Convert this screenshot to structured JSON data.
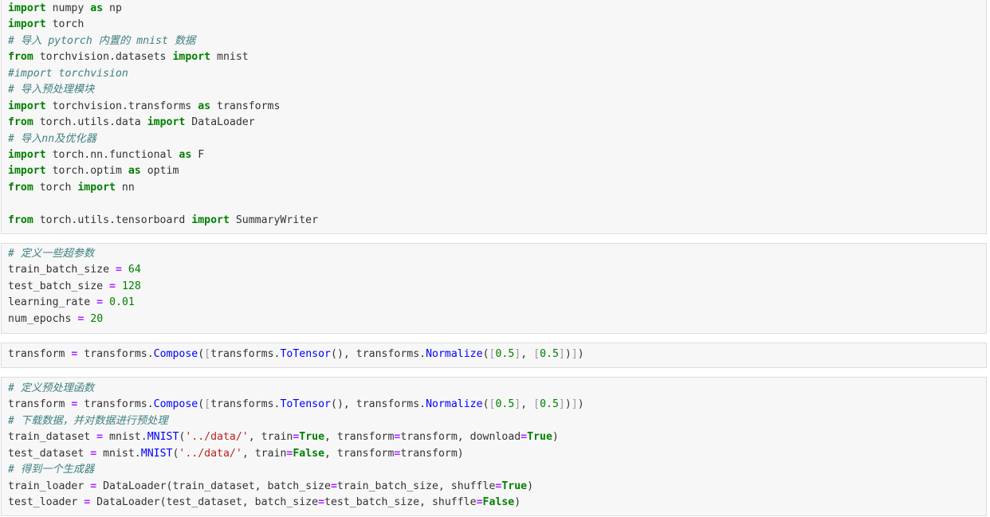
{
  "cells": [
    {
      "lines": [
        [
          [
            "kw",
            "import"
          ],
          [
            "t",
            " numpy "
          ],
          [
            "kw",
            "as"
          ],
          [
            "t",
            " np"
          ]
        ],
        [
          [
            "kw",
            "import"
          ],
          [
            "t",
            " torch"
          ]
        ],
        [
          [
            "cm",
            "# 导入 pytorch 内置的 mnist 数据"
          ]
        ],
        [
          [
            "kw",
            "from"
          ],
          [
            "t",
            " torchvision.datasets "
          ],
          [
            "kw",
            "import"
          ],
          [
            "t",
            " mnist"
          ]
        ],
        [
          [
            "cm",
            "#import torchvision"
          ]
        ],
        [
          [
            "cm",
            "# 导入预处理模块"
          ]
        ],
        [
          [
            "kw",
            "import"
          ],
          [
            "t",
            " torchvision.transforms "
          ],
          [
            "kw",
            "as"
          ],
          [
            "t",
            " transforms"
          ]
        ],
        [
          [
            "kw",
            "from"
          ],
          [
            "t",
            " torch.utils.data "
          ],
          [
            "kw",
            "import"
          ],
          [
            "t",
            " DataLoader"
          ]
        ],
        [
          [
            "cm",
            "# 导入nn及优化器"
          ]
        ],
        [
          [
            "kw",
            "import"
          ],
          [
            "t",
            " torch.nn.functional "
          ],
          [
            "kw",
            "as"
          ],
          [
            "t",
            " F"
          ]
        ],
        [
          [
            "kw",
            "import"
          ],
          [
            "t",
            " torch.optim "
          ],
          [
            "kw",
            "as"
          ],
          [
            "t",
            " optim"
          ]
        ],
        [
          [
            "kw",
            "from"
          ],
          [
            "t",
            " torch "
          ],
          [
            "kw",
            "import"
          ],
          [
            "t",
            " nn"
          ]
        ],
        [],
        [
          [
            "kw",
            "from"
          ],
          [
            "t",
            " torch.utils.tensorboard "
          ],
          [
            "kw",
            "import"
          ],
          [
            "t",
            " SummaryWriter"
          ]
        ]
      ]
    },
    {
      "lines": [
        [
          [
            "cm",
            "# 定义一些超参数"
          ]
        ],
        [
          [
            "t",
            "train_batch_size "
          ],
          [
            "op",
            "="
          ],
          [
            "t",
            " "
          ],
          [
            "num",
            "64"
          ]
        ],
        [
          [
            "t",
            "test_batch_size "
          ],
          [
            "op",
            "="
          ],
          [
            "t",
            " "
          ],
          [
            "num",
            "128"
          ]
        ],
        [
          [
            "t",
            "learning_rate "
          ],
          [
            "op",
            "="
          ],
          [
            "t",
            " "
          ],
          [
            "num",
            "0.01"
          ]
        ],
        [
          [
            "t",
            "num_epochs "
          ],
          [
            "op",
            "="
          ],
          [
            "t",
            " "
          ],
          [
            "num",
            "20"
          ]
        ]
      ]
    },
    {
      "lines": [
        [
          [
            "t",
            "transform "
          ],
          [
            "op",
            "="
          ],
          [
            "t",
            " transforms."
          ],
          [
            "fn",
            "Compose"
          ],
          [
            "t",
            "("
          ],
          [
            "br",
            "["
          ],
          [
            "t",
            "transforms."
          ],
          [
            "fn",
            "ToTensor"
          ],
          [
            "t",
            "(), transforms."
          ],
          [
            "fn",
            "Normalize"
          ],
          [
            "t",
            "("
          ],
          [
            "br",
            "["
          ],
          [
            "num",
            "0.5"
          ],
          [
            "br",
            "]"
          ],
          [
            "t",
            ", "
          ],
          [
            "br",
            "["
          ],
          [
            "num",
            "0.5"
          ],
          [
            "br",
            "]"
          ],
          [
            "t",
            ")"
          ],
          [
            "br",
            "]"
          ],
          [
            "t",
            ")"
          ]
        ]
      ]
    },
    {
      "lines": [
        [
          [
            "cm",
            "# 定义预处理函数"
          ]
        ],
        [
          [
            "t",
            "transform "
          ],
          [
            "op",
            "="
          ],
          [
            "t",
            " transforms."
          ],
          [
            "fn",
            "Compose"
          ],
          [
            "t",
            "("
          ],
          [
            "br",
            "["
          ],
          [
            "t",
            "transforms."
          ],
          [
            "fn",
            "ToTensor"
          ],
          [
            "t",
            "(), transforms."
          ],
          [
            "fn",
            "Normalize"
          ],
          [
            "t",
            "("
          ],
          [
            "br",
            "["
          ],
          [
            "num",
            "0.5"
          ],
          [
            "br",
            "]"
          ],
          [
            "t",
            ", "
          ],
          [
            "br",
            "["
          ],
          [
            "num",
            "0.5"
          ],
          [
            "br",
            "]"
          ],
          [
            "t",
            ")"
          ],
          [
            "br",
            "]"
          ],
          [
            "t",
            ")"
          ]
        ],
        [
          [
            "cm",
            "# 下载数据，并对数据进行预处理"
          ]
        ],
        [
          [
            "t",
            "train_dataset "
          ],
          [
            "op",
            "="
          ],
          [
            "t",
            " mnist."
          ],
          [
            "fn",
            "MNIST"
          ],
          [
            "t",
            "("
          ],
          [
            "str",
            "'../data/'"
          ],
          [
            "t",
            ", train"
          ],
          [
            "op",
            "="
          ],
          [
            "bi",
            "True"
          ],
          [
            "t",
            ", transform"
          ],
          [
            "op",
            "="
          ],
          [
            "t",
            "transform, download"
          ],
          [
            "op",
            "="
          ],
          [
            "bi",
            "True"
          ],
          [
            "t",
            ")"
          ]
        ],
        [
          [
            "t",
            "test_dataset "
          ],
          [
            "op",
            "="
          ],
          [
            "t",
            " mnist."
          ],
          [
            "fn",
            "MNIST"
          ],
          [
            "t",
            "("
          ],
          [
            "str",
            "'../data/'"
          ],
          [
            "t",
            ", train"
          ],
          [
            "op",
            "="
          ],
          [
            "bi",
            "False"
          ],
          [
            "t",
            ", transform"
          ],
          [
            "op",
            "="
          ],
          [
            "t",
            "transform)"
          ]
        ],
        [
          [
            "cm",
            "# 得到一个生成器"
          ]
        ],
        [
          [
            "t",
            "train_loader "
          ],
          [
            "op",
            "="
          ],
          [
            "t",
            " DataLoader(train_dataset, batch_size"
          ],
          [
            "op",
            "="
          ],
          [
            "t",
            "train_batch_size, shuffle"
          ],
          [
            "op",
            "="
          ],
          [
            "bi",
            "True"
          ],
          [
            "t",
            ")"
          ]
        ],
        [
          [
            "t",
            "test_loader "
          ],
          [
            "op",
            "="
          ],
          [
            "t",
            " DataLoader(test_dataset, batch_size"
          ],
          [
            "op",
            "="
          ],
          [
            "t",
            "test_batch_size, shuffle"
          ],
          [
            "op",
            "="
          ],
          [
            "bi",
            "False"
          ],
          [
            "t",
            ")"
          ]
        ]
      ]
    }
  ]
}
